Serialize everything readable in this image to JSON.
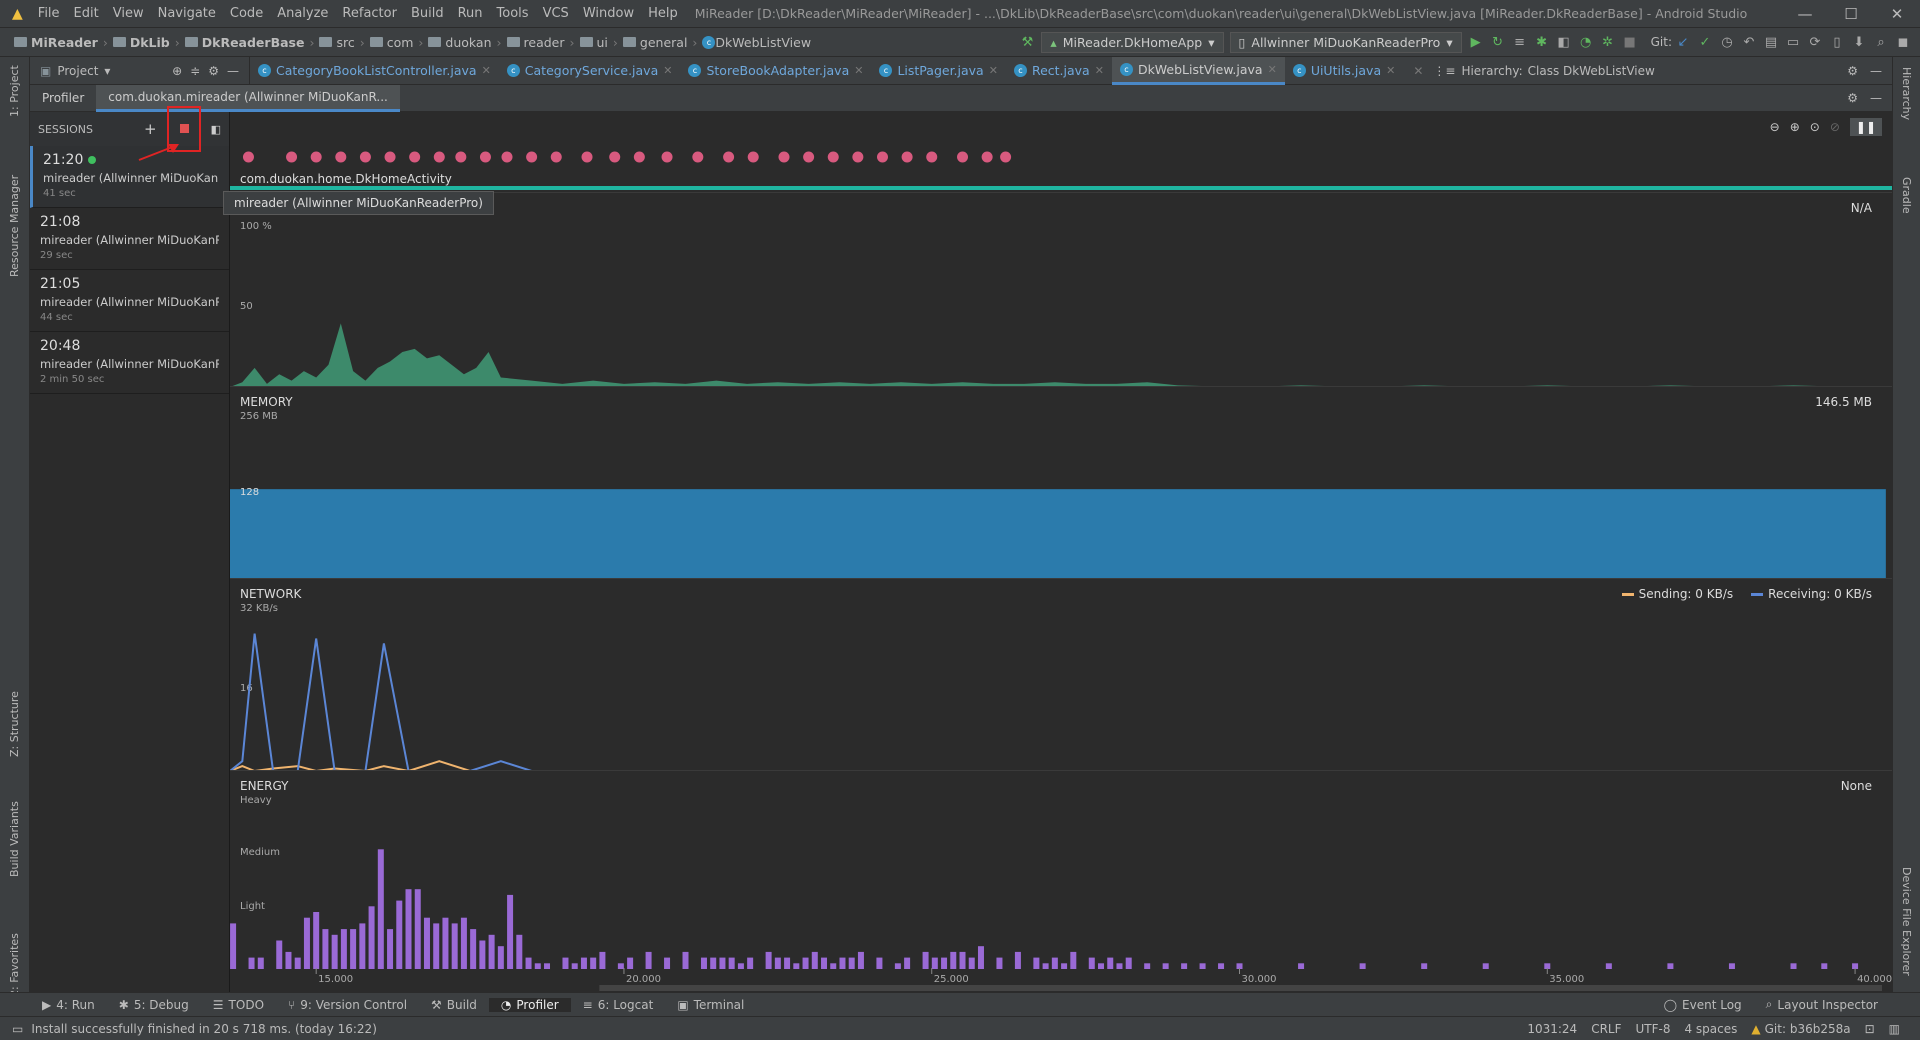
{
  "window": {
    "title": "MiReader [D:\\DkReader\\MiReader\\MiReader] - ...\\DkLib\\DkReaderBase\\src\\com\\duokan\\reader\\ui\\general\\DkWebListView.java [MiReader.DkReaderBase] - Android Studio",
    "menu": [
      "File",
      "Edit",
      "View",
      "Navigate",
      "Code",
      "Analyze",
      "Refactor",
      "Build",
      "Run",
      "Tools",
      "VCS",
      "Window",
      "Help"
    ],
    "minimize": "—",
    "maximize": "☐",
    "close": "✕"
  },
  "breadcrumbs": [
    "MiReader",
    "DkLib",
    "DkReaderBase",
    "src",
    "com",
    "duokan",
    "reader",
    "ui",
    "general",
    "DkWebListView"
  ],
  "run_config": "MiReader.DkHomeApp",
  "device": "Allwinner MiDuoKanReaderPro",
  "git_label": "Git:",
  "project_panel": {
    "label": "Project"
  },
  "tabs": [
    {
      "label": "CategoryBookListController.java"
    },
    {
      "label": "CategoryService.java"
    },
    {
      "label": "StoreBookAdapter.java"
    },
    {
      "label": "ListPager.java"
    },
    {
      "label": "Rect.java"
    },
    {
      "label": "DkWebListView.java"
    },
    {
      "label": "UiUtils.java"
    }
  ],
  "hierarchy_label": "Hierarchy:",
  "hierarchy_value": "Class DkWebListView",
  "profiler": {
    "tab_label": "Profiler",
    "session_tab": "com.duokan.mireader (Allwinner MiDuoKanR...",
    "sessions_label": "SESSIONS",
    "sessions": [
      {
        "time": "21:20",
        "device": "mireader (Allwinner MiDuoKanR...",
        "length": "41 sec",
        "live": true
      },
      {
        "time": "21:08",
        "device": "mireader (Allwinner MiDuoKanR...",
        "length": "29 sec",
        "live": false
      },
      {
        "time": "21:05",
        "device": "mireader (Allwinner MiDuoKanR...",
        "length": "44 sec",
        "live": false
      },
      {
        "time": "20:48",
        "device": "mireader (Allwinner MiDuoKanR...",
        "length": "2 min 50 sec",
        "live": false
      }
    ],
    "activity": "com.duokan.home.DkHomeActivity",
    "tooltip": "mireader (Allwinner MiDuoKanReaderPro)",
    "cpu": {
      "value": "N/A",
      "y_top": "100 %",
      "y_mid": "50"
    },
    "memory": {
      "title": "MEMORY",
      "value": "146.5 MB",
      "y_top": "256 MB",
      "y_mid": "128"
    },
    "network": {
      "title": "NETWORK",
      "y_top": "32 KB/s",
      "y_mid": "16",
      "sending": "Sending: 0 KB/s",
      "receiving": "Receiving: 0 KB/s"
    },
    "energy": {
      "title": "ENERGY",
      "value": "None",
      "heavy": "Heavy",
      "medium": "Medium",
      "light": "Light"
    },
    "time_axis": [
      "15.000",
      "20.000",
      "25.000",
      "30.000",
      "35.000",
      "40.000"
    ]
  },
  "colors": {
    "cpu": "#3d8a6b",
    "memory": "#2b7bac",
    "sending": "#f0b46e",
    "receiving": "#5b86d6",
    "energy": "#9a6ad6",
    "event": "#d85a7f",
    "accent": "#1fb5a0"
  },
  "tool_windows": {
    "left": [
      "1: Project",
      "Resource Manager",
      "Z: Structure",
      "Build Variants",
      "2: Favorites"
    ],
    "right": [
      "Hierarchy",
      "Gradle",
      "Device File Explorer"
    ]
  },
  "bottom_tools": [
    "4: Run",
    "5: Debug",
    "TODO",
    "9: Version Control",
    "Build",
    "Profiler",
    "6: Logcat",
    "Terminal"
  ],
  "bottom_right": [
    "Event Log",
    "Layout Inspector"
  ],
  "status": {
    "message": "Install successfully finished in 20 s 718 ms. (today 16:22)",
    "position": "1031:24",
    "line_sep": "CRLF",
    "encoding": "UTF-8",
    "indent": "4 spaces",
    "git": "Git: b36b258a"
  },
  "chart_data": [
    {
      "type": "area",
      "title": "CPU",
      "ylim": [
        0,
        100
      ],
      "x": [
        13.6,
        13.8,
        14.0,
        14.2,
        14.4,
        14.6,
        14.8,
        15.0,
        15.2,
        15.4,
        15.6,
        15.8,
        16.0,
        16.2,
        16.4,
        16.6,
        16.8,
        17.0,
        17.2,
        17.4,
        17.6,
        17.8,
        18.0,
        18.5,
        19.0,
        19.5,
        20.0,
        20.5,
        21.0,
        21.5,
        22.0,
        22.5,
        23.0,
        23.5,
        24.0,
        24.5,
        25.0,
        25.5,
        26.0,
        26.5,
        27.0,
        27.5,
        28.0,
        28.5,
        29.0,
        30,
        31,
        32,
        33,
        34,
        35,
        36,
        37,
        38,
        39,
        40
      ],
      "values": [
        0,
        3,
        12,
        2,
        8,
        4,
        10,
        6,
        14,
        40,
        10,
        4,
        12,
        16,
        22,
        24,
        18,
        20,
        14,
        8,
        12,
        22,
        6,
        4,
        2,
        4,
        2,
        3,
        2,
        4,
        2,
        3,
        2,
        3,
        2,
        3,
        2,
        3,
        2,
        2,
        3,
        2,
        2,
        3,
        1,
        0,
        1,
        0,
        1,
        0,
        1,
        0,
        1,
        0,
        1,
        0
      ]
    },
    {
      "type": "area",
      "title": "MEMORY",
      "ylim": [
        0,
        256
      ],
      "x": [
        13.6,
        40.5
      ],
      "values": [
        146.5,
        146.5
      ]
    },
    {
      "type": "line",
      "title": "NETWORK",
      "ylim": [
        0,
        32
      ],
      "x": [
        13.6,
        13.8,
        14.0,
        14.3,
        14.7,
        15.0,
        15.3,
        15.8,
        16.1,
        16.5,
        17.0,
        17.5,
        18.0,
        18.5,
        19.0,
        20.0
      ],
      "series": [
        {
          "name": "Sending",
          "values": [
            0,
            1,
            0,
            0.5,
            1,
            0,
            0.5,
            0,
            1,
            0,
            2,
            0,
            0,
            0,
            0,
            0
          ]
        },
        {
          "name": "Receiving",
          "values": [
            0,
            2,
            28,
            0,
            0,
            27,
            0,
            0,
            26,
            0,
            0,
            0,
            2,
            0,
            0,
            0
          ]
        }
      ]
    },
    {
      "type": "bar",
      "title": "ENERGY",
      "ylim": [
        0,
        3
      ],
      "x": [
        13.65,
        13.8,
        13.95,
        14.1,
        14.25,
        14.4,
        14.55,
        14.7,
        14.85,
        15.0,
        15.15,
        15.3,
        15.45,
        15.6,
        15.75,
        15.9,
        16.05,
        16.2,
        16.35,
        16.5,
        16.65,
        16.8,
        16.95,
        17.1,
        17.25,
        17.4,
        17.55,
        17.7,
        17.85,
        18.0,
        18.15,
        18.3,
        18.45,
        18.6,
        18.75,
        18.9,
        19.05,
        19.2,
        19.35,
        19.5,
        19.65,
        19.8,
        19.95,
        20.1,
        20.25,
        20.4,
        20.55,
        20.7,
        20.85,
        21.0,
        21.15,
        21.3,
        21.45,
        21.6,
        21.75,
        21.9,
        22.05,
        22.2,
        22.35,
        22.5,
        22.65,
        22.8,
        22.95,
        23.1,
        23.25,
        23.4,
        23.55,
        23.7,
        23.85,
        24.0,
        24.15,
        24.3,
        24.45,
        24.6,
        24.75,
        24.9,
        25.05,
        25.2,
        25.35,
        25.5,
        25.65,
        25.8,
        25.95,
        26.1,
        26.25,
        26.4,
        26.55,
        26.7,
        26.85,
        27.0,
        27.15,
        27.3,
        27.45,
        27.6,
        27.75,
        27.9,
        28.05,
        28.2,
        28.35,
        28.5,
        28.65,
        28.8,
        28.95,
        29.1,
        29.25,
        29.4,
        29.55,
        29.7,
        29.85,
        30.0,
        30.5,
        31.0,
        31.5,
        32.0,
        32.5,
        33.0,
        33.5,
        34.0,
        34.5,
        35.0,
        35.5,
        36.0,
        36.5,
        37.0,
        37.5,
        38.0,
        38.5,
        39.0,
        39.5,
        40.0,
        40.5
      ],
      "values": [
        0.8,
        0,
        0.2,
        0.2,
        0,
        0.5,
        0.3,
        0.2,
        0.9,
        1.0,
        0.7,
        0.6,
        0.7,
        0.7,
        0.8,
        1.1,
        2.1,
        0.7,
        1.2,
        1.4,
        1.4,
        0.9,
        0.8,
        0.9,
        0.8,
        0.9,
        0.7,
        0.5,
        0.6,
        0.4,
        1.3,
        0.6,
        0.2,
        0.1,
        0.1,
        0,
        0.2,
        0.1,
        0.2,
        0.2,
        0.3,
        0,
        0.1,
        0.2,
        0,
        0.3,
        0,
        0.2,
        0,
        0.3,
        0,
        0.2,
        0.2,
        0.2,
        0.2,
        0.1,
        0.2,
        0,
        0.3,
        0.2,
        0.2,
        0.1,
        0.2,
        0.3,
        0.2,
        0.1,
        0.2,
        0.2,
        0.3,
        0,
        0.2,
        0,
        0.1,
        0.2,
        0,
        0.3,
        0.2,
        0.2,
        0.3,
        0.3,
        0.2,
        0.4,
        0,
        0.2,
        0,
        0.3,
        0,
        0.2,
        0.1,
        0.2,
        0.1,
        0.3,
        0,
        0.2,
        0.1,
        0.2,
        0.1,
        0.2,
        0,
        0.1,
        0,
        0.1,
        0,
        0.1,
        0,
        0.1,
        0,
        0.1,
        0,
        0.1,
        0,
        0.1,
        0,
        0.1,
        0,
        0.1,
        0,
        0.1,
        0,
        0.1,
        0,
        0.1,
        0,
        0.1,
        0,
        0.1,
        0,
        0.1,
        0.1,
        0.1,
        0
      ]
    }
  ]
}
